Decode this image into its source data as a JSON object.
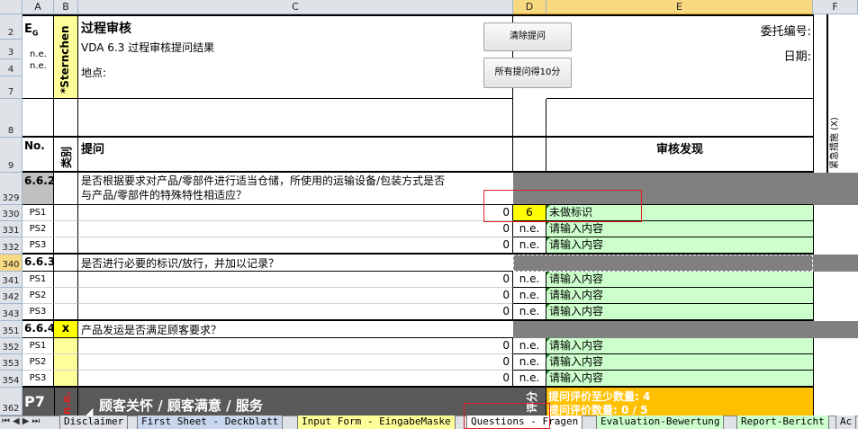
{
  "columns": [
    "A",
    "B",
    "C",
    "D",
    "E",
    "F"
  ],
  "row_numbers": [
    "2",
    "3",
    "4",
    "7",
    "8",
    "9",
    "329",
    "330",
    "331",
    "332",
    "340",
    "341",
    "342",
    "343",
    "351",
    "352",
    "353",
    "354",
    "362"
  ],
  "header": {
    "eg": "E",
    "eg_sub": "G",
    "ne1": "n.e.",
    "ne2": "n.e.",
    "sternchen": "*Sternchen",
    "title": "过程审核",
    "subtitle": "VDA 6.3 过程审核提问结果",
    "location_label": "地点:",
    "btn_clear": "清除提问",
    "btn_all10": "所有提问得10分",
    "commission_label": "委托编号:",
    "date_label": "日期:",
    "col_no": "No.",
    "col_category": "类别",
    "col_question": "提问",
    "col_findings": "审核发现",
    "col_urgent": "紧急措施 (X)"
  },
  "sections": {
    "s662": {
      "no": "6.6.2",
      "question": "是否根据要求对产品/零部件进行适当仓储，所使用的运输设备/包装方式是否",
      "question2": "与产品/零部件的特殊特性相适应？",
      "ps": [
        {
          "label": "PS1",
          "zero": "0",
          "score": "6",
          "finding": "未做标识"
        },
        {
          "label": "PS2",
          "zero": "0",
          "score": "n.e.",
          "finding": "请输入内容"
        },
        {
          "label": "PS3",
          "zero": "0",
          "score": "n.e.",
          "finding": "请输入内容"
        }
      ]
    },
    "s663": {
      "no": "6.6.3",
      "question": "是否进行必要的标识/放行，并加以记录？",
      "ps": [
        {
          "label": "PS1",
          "zero": "0",
          "score": "n.e.",
          "finding": "请输入内容"
        },
        {
          "label": "PS2",
          "zero": "0",
          "score": "n.e.",
          "finding": "请输入内容"
        },
        {
          "label": "PS3",
          "zero": "0",
          "score": "n.e.",
          "finding": "请输入内容"
        }
      ]
    },
    "s664": {
      "no": "6.6.4",
      "mark": "x",
      "question": "产品发运是否满足顾客要求？",
      "ps": [
        {
          "label": "PS1",
          "zero": "0",
          "score": "n.e.",
          "finding": "请输入内容"
        },
        {
          "label": "PS2",
          "zero": "0",
          "score": "n.e.",
          "finding": "请输入内容"
        },
        {
          "label": "PS3",
          "zero": "0",
          "score": "n.e.",
          "finding": "请输入内容"
        }
      ]
    },
    "p7": {
      "no": "P7",
      "ne": "n.e.",
      "title": "顾客关怀 / 顾客满意 / 服务",
      "score_vertical": "评分",
      "min_label": "提问评价至少数量: 4",
      "count_label": "提问评价数量: 0 /  5"
    }
  },
  "tabs": [
    {
      "label": "Disclaimer",
      "color": "#dfe3e8"
    },
    {
      "label": "First Sheet - Deckblatt",
      "color": "#c9d7ee"
    },
    {
      "label": "Input Form - EingabeMaske",
      "color": "#ffff99"
    },
    {
      "label": "Questions - Fragen",
      "color": "#ffffff"
    },
    {
      "label": "Evaluation-Bewertung",
      "color": "#ccffcc"
    },
    {
      "label": "Report-Bericht",
      "color": "#ccffcc"
    },
    {
      "label": "Ac",
      "color": "#dfe3e8"
    }
  ],
  "colors": {
    "yellow": "#ffff99",
    "green": "#ccffcc",
    "gray": "#808080",
    "orange": "#ffc000",
    "red": "#e02020"
  }
}
